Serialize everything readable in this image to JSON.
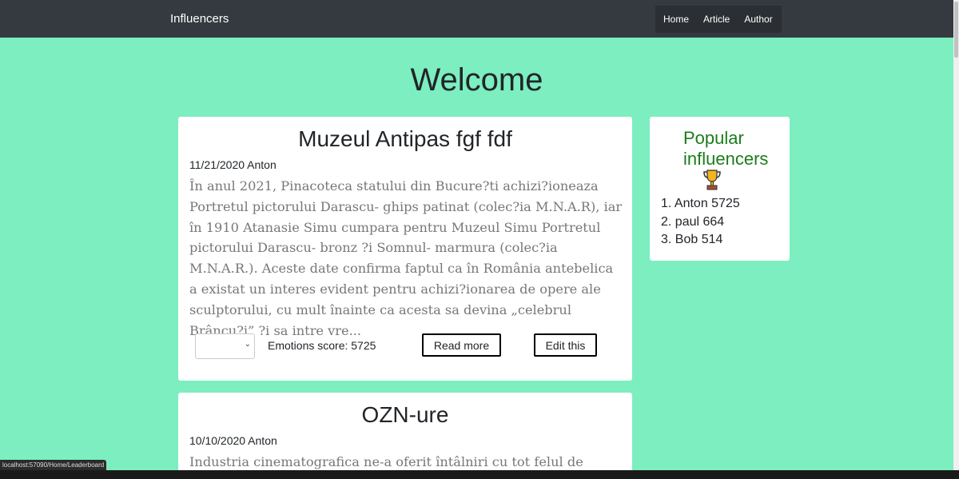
{
  "navbar": {
    "brand": "Influencers",
    "links": [
      "Home",
      "Article",
      "Author"
    ]
  },
  "page": {
    "heading": "Welcome"
  },
  "articles": [
    {
      "title": "Muzeul Antipas fgf fdf",
      "meta": "11/21/2020 Anton",
      "body": "În anul 2021, Pinacoteca statului din Bucure?ti achizi?ioneaza Portretul pictorului Darascu- ghips patinat (colec?ia M.N.A.R), iar în 1910 Atanasie Simu cumpara pentru Muzeul Simu Portretul pictorului Darascu- bronz ?i Somnul- marmura (colec?ia M.N.A.R.). Aceste date confirma faptul ca în România antebelica a existat un interes evident pentru achizi?ionarea de opere ale sculptorului, cu mult înainte ca acesta sa devina „celebrul Brâncu?i” ?i sa intre vre...",
      "select_value": "",
      "emotions": "Emotions score: 5725",
      "read_more": "Read more",
      "edit": "Edit this"
    },
    {
      "title": "OZN-ure",
      "meta": "10/10/2020 Anton",
      "body": "Industria cinematografica ne-a oferit întâlniri cu tot felul de invadatori sariti"
    }
  ],
  "sidebar": {
    "title_line1": "Popular",
    "title_line2": "influencers",
    "icon": "trophy-icon",
    "leaders": [
      "1. Anton 5725",
      "2. paul 664",
      "3. Bob 514"
    ]
  },
  "status_url": "localhost:57090/Home/Leaderboard",
  "colors": {
    "background": "#7ceec0",
    "navbar": "#343a40",
    "sidebar_title": "#1c7c1c"
  }
}
